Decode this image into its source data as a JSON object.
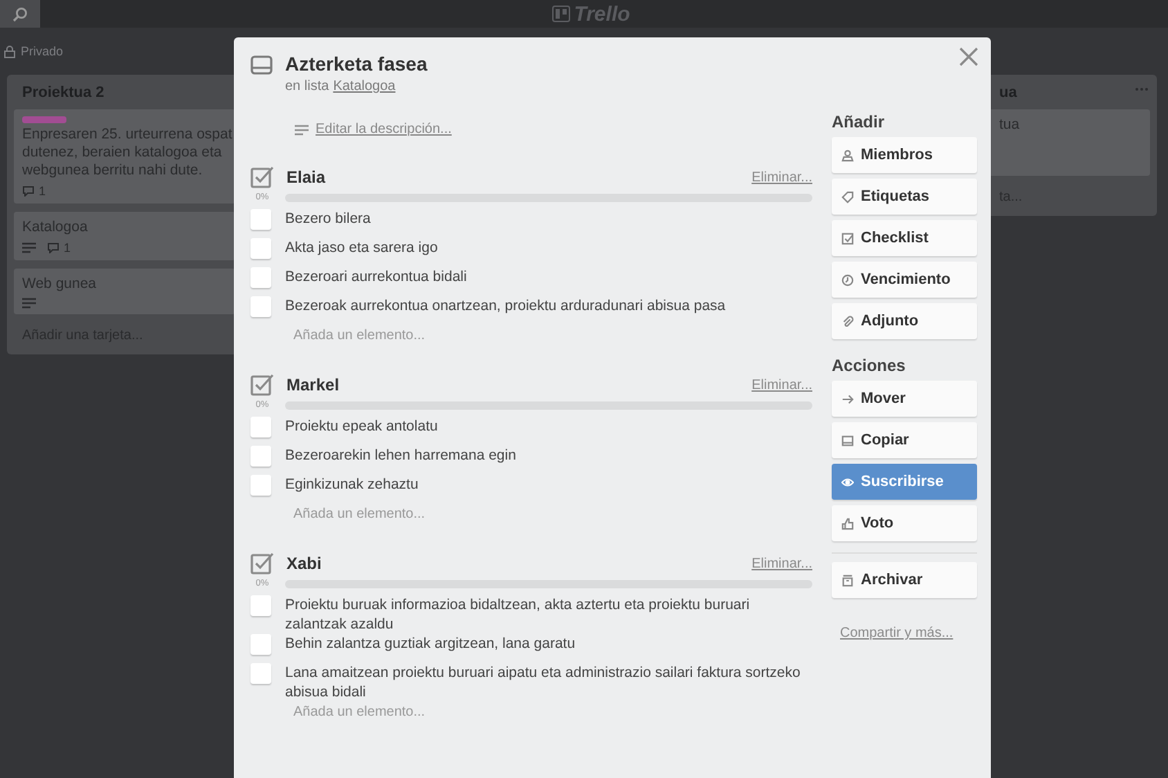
{
  "header": {
    "logo": "Trello"
  },
  "board": {
    "visibility": "Privado",
    "lists": [
      {
        "title": "Proiektua 2",
        "menu": false,
        "cards": [
          {
            "color": "#a24d93",
            "lines": [
              "Enpresaren 25. urteurrena ospat",
              "dutenez, beraien katalogoa eta",
              "webgunea berritu nahi dute."
            ],
            "description": false,
            "comments": "1"
          },
          {
            "lines": [
              "Katalogoa"
            ],
            "description": true,
            "comments": "1"
          },
          {
            "lines": [
              "Web gunea"
            ],
            "description": true
          }
        ],
        "add": "Añadir una tarjeta..."
      },
      {
        "title": "ua",
        "menu": true,
        "cards": [
          {
            "lines": [
              "tua"
            ],
            "description": false
          }
        ],
        "add": "ta..."
      }
    ]
  },
  "card_modal": {
    "title": "Azterketa fasea",
    "list_prefix": "en lista",
    "list_link": "Katalogoa",
    "edit_description": "Editar la descripción...",
    "checklists": [
      {
        "title": "Elaia",
        "delete": "Eliminar...",
        "percent": "0%",
        "level": 0,
        "items": [
          {
            "text": "Bezero bilera",
            "checked": false
          },
          {
            "text": "Akta jaso eta sarera igo",
            "checked": false
          },
          {
            "text": "Bezeroari aurrekontua bidali",
            "checked": false
          },
          {
            "text": "Bezeroak aurrekontua onartzean, proiektu arduradunari abisua pasa",
            "checked": false
          }
        ],
        "add": "Añada un elemento..."
      },
      {
        "title": "Markel",
        "delete": "Eliminar...",
        "percent": "0%",
        "level": 0,
        "items": [
          {
            "text": "Proiektu epeak antolatu",
            "checked": false
          },
          {
            "text": "Bezeroarekin lehen harremana egin",
            "checked": false
          },
          {
            "text": "Eginkizunak zehaztu",
            "checked": false
          }
        ],
        "add": "Añada un elemento..."
      },
      {
        "title": "Xabi",
        "delete": "Eliminar...",
        "percent": "0%",
        "level": 0,
        "items": [
          {
            "text": "Proiektu buruak informazioa bidaltzean, akta aztertu eta proiektu buruari zalantzak azaldu",
            "checked": false
          },
          {
            "text": "Behin zalantza guztiak argitzean, lana garatu",
            "checked": false
          },
          {
            "text": "Lana amaitzean proiektu buruari aipatu eta administrazio sailari faktura sortzeko abisua bidali",
            "checked": false
          }
        ],
        "add": "Añada un elemento..."
      }
    ],
    "sidebar": {
      "groups": [
        {
          "heading": "Añadir",
          "buttons": [
            {
              "label": "Miembros",
              "kind": "members",
              "selected": false
            },
            {
              "label": "Etiquetas",
              "kind": "labels",
              "selected": false
            },
            {
              "label": "Checklist",
              "kind": "checklist",
              "selected": false
            },
            {
              "label": "Vencimiento",
              "kind": "due",
              "selected": false
            },
            {
              "label": "Adjunto",
              "kind": "attach",
              "selected": false
            }
          ]
        },
        {
          "heading": "Acciones",
          "buttons": [
            {
              "label": "Mover",
              "kind": "move",
              "selected": false
            },
            {
              "label": "Copiar",
              "kind": "copy",
              "selected": false
            },
            {
              "label": "Suscribirse",
              "kind": "watch",
              "selected": true
            },
            {
              "label": "Voto",
              "kind": "vote",
              "selected": false
            }
          ]
        },
        {
          "buttons": [
            {
              "label": "Archivar",
              "kind": "archive",
              "selected": false
            }
          ]
        }
      ],
      "share": "Compartir y más..."
    }
  }
}
